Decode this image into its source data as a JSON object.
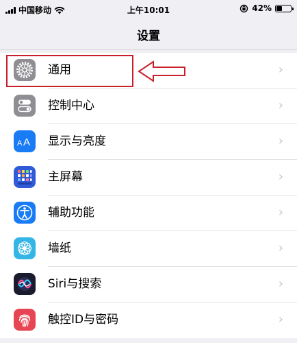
{
  "status_bar": {
    "carrier": "中国移动",
    "time": "上午10:01",
    "battery_text": "42%",
    "battery_level": 0.42
  },
  "nav": {
    "title": "设置"
  },
  "settings": [
    {
      "label": "通用",
      "icon": "gear-icon",
      "color": "#8e8e93"
    },
    {
      "label": "控制中心",
      "icon": "toggle-icon",
      "color": "#8e8e93"
    },
    {
      "label": "显示与亮度",
      "icon": "text-size-icon",
      "color": "#1a7cf5"
    },
    {
      "label": "主屏幕",
      "icon": "home-screen-icon",
      "color": "#2f5ad8"
    },
    {
      "label": "辅助功能",
      "icon": "accessibility-icon",
      "color": "#1a7cf5"
    },
    {
      "label": "墙纸",
      "icon": "flower-icon",
      "color": "#33b5e5"
    },
    {
      "label": "Siri与搜索",
      "icon": "siri-icon",
      "color": "#1b1b2e"
    },
    {
      "label": "触控ID与密码",
      "icon": "fingerprint-icon",
      "color": "#e64553"
    }
  ],
  "annotation": {
    "highlight_color": "#c8202b"
  }
}
